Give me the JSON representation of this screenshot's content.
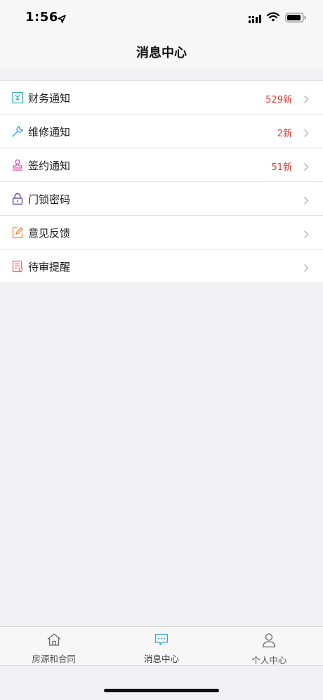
{
  "status_bar": {
    "time": "1:56"
  },
  "nav": {
    "title": "消息中心"
  },
  "list": {
    "items": [
      {
        "label": "财务通知",
        "badge": "529新",
        "icon": "finance-icon"
      },
      {
        "label": "维修通知",
        "badge": "2新",
        "icon": "wrench-icon"
      },
      {
        "label": "签约通知",
        "badge": "51新",
        "icon": "stamp-icon"
      },
      {
        "label": "门锁密码",
        "badge": "",
        "icon": "lock-icon"
      },
      {
        "label": "意见反馈",
        "badge": "",
        "icon": "edit-icon"
      },
      {
        "label": "待审提醒",
        "badge": "",
        "icon": "document-icon"
      }
    ]
  },
  "tab_bar": {
    "tabs": [
      {
        "label": "房源和合同",
        "icon": "house-icon"
      },
      {
        "label": "消息中心",
        "icon": "message-icon"
      },
      {
        "label": "个人中心",
        "icon": "person-icon"
      }
    ],
    "active_index": 1
  },
  "colors": {
    "badge": "#e8382f",
    "finance_icon": "#2bb5b0",
    "wrench_icon": "#3aa0e0",
    "stamp_icon": "#e14fb0",
    "lock_icon": "#6a4fb0",
    "edit_icon": "#f0863a",
    "document_icon": "#e86a6a",
    "active_tab_icon": "#3aa8c8"
  }
}
